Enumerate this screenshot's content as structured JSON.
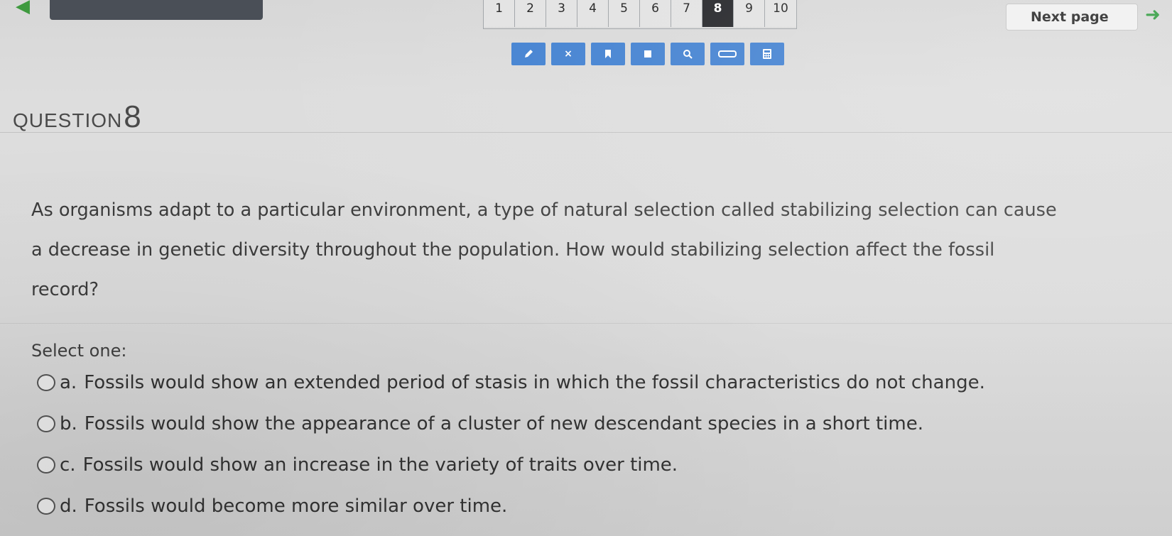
{
  "nav": {
    "pages": [
      "1",
      "2",
      "3",
      "4",
      "5",
      "6",
      "7",
      "8",
      "9",
      "10"
    ],
    "current_page": "8",
    "next_label": "Next page"
  },
  "toolbar": {
    "tools": [
      "pencil-icon",
      "close-icon",
      "bookmark-icon",
      "highlighter-icon",
      "magnifier-icon",
      "line-reader-icon",
      "calculator-icon"
    ],
    "close_glyph": "×"
  },
  "question": {
    "header_word": "QUESTION",
    "header_number": "8",
    "text_lines": [
      "As organisms adapt to a particular environment, a type of natural selection called stabilizing selection can cause",
      "a decrease in genetic diversity throughout the population. How would stabilizing selection affect the fossil",
      "record?"
    ],
    "select_prompt": "Select one:",
    "options": [
      {
        "letter": "a.",
        "text": "Fossils would show an extended period of stasis in which the fossil characteristics do not change."
      },
      {
        "letter": "b.",
        "text": "Fossils would show the appearance of a cluster of new descendant species in a short time."
      },
      {
        "letter": "c.",
        "text": "Fossils would show an increase in the variety of traits over time."
      },
      {
        "letter": "d.",
        "text": "Fossils would become more similar over time."
      }
    ]
  },
  "colors": {
    "tool_blue": "#3f7fd0",
    "next_arrow_green": "#2e9b3d",
    "current_page_bg": "#1f2024"
  }
}
